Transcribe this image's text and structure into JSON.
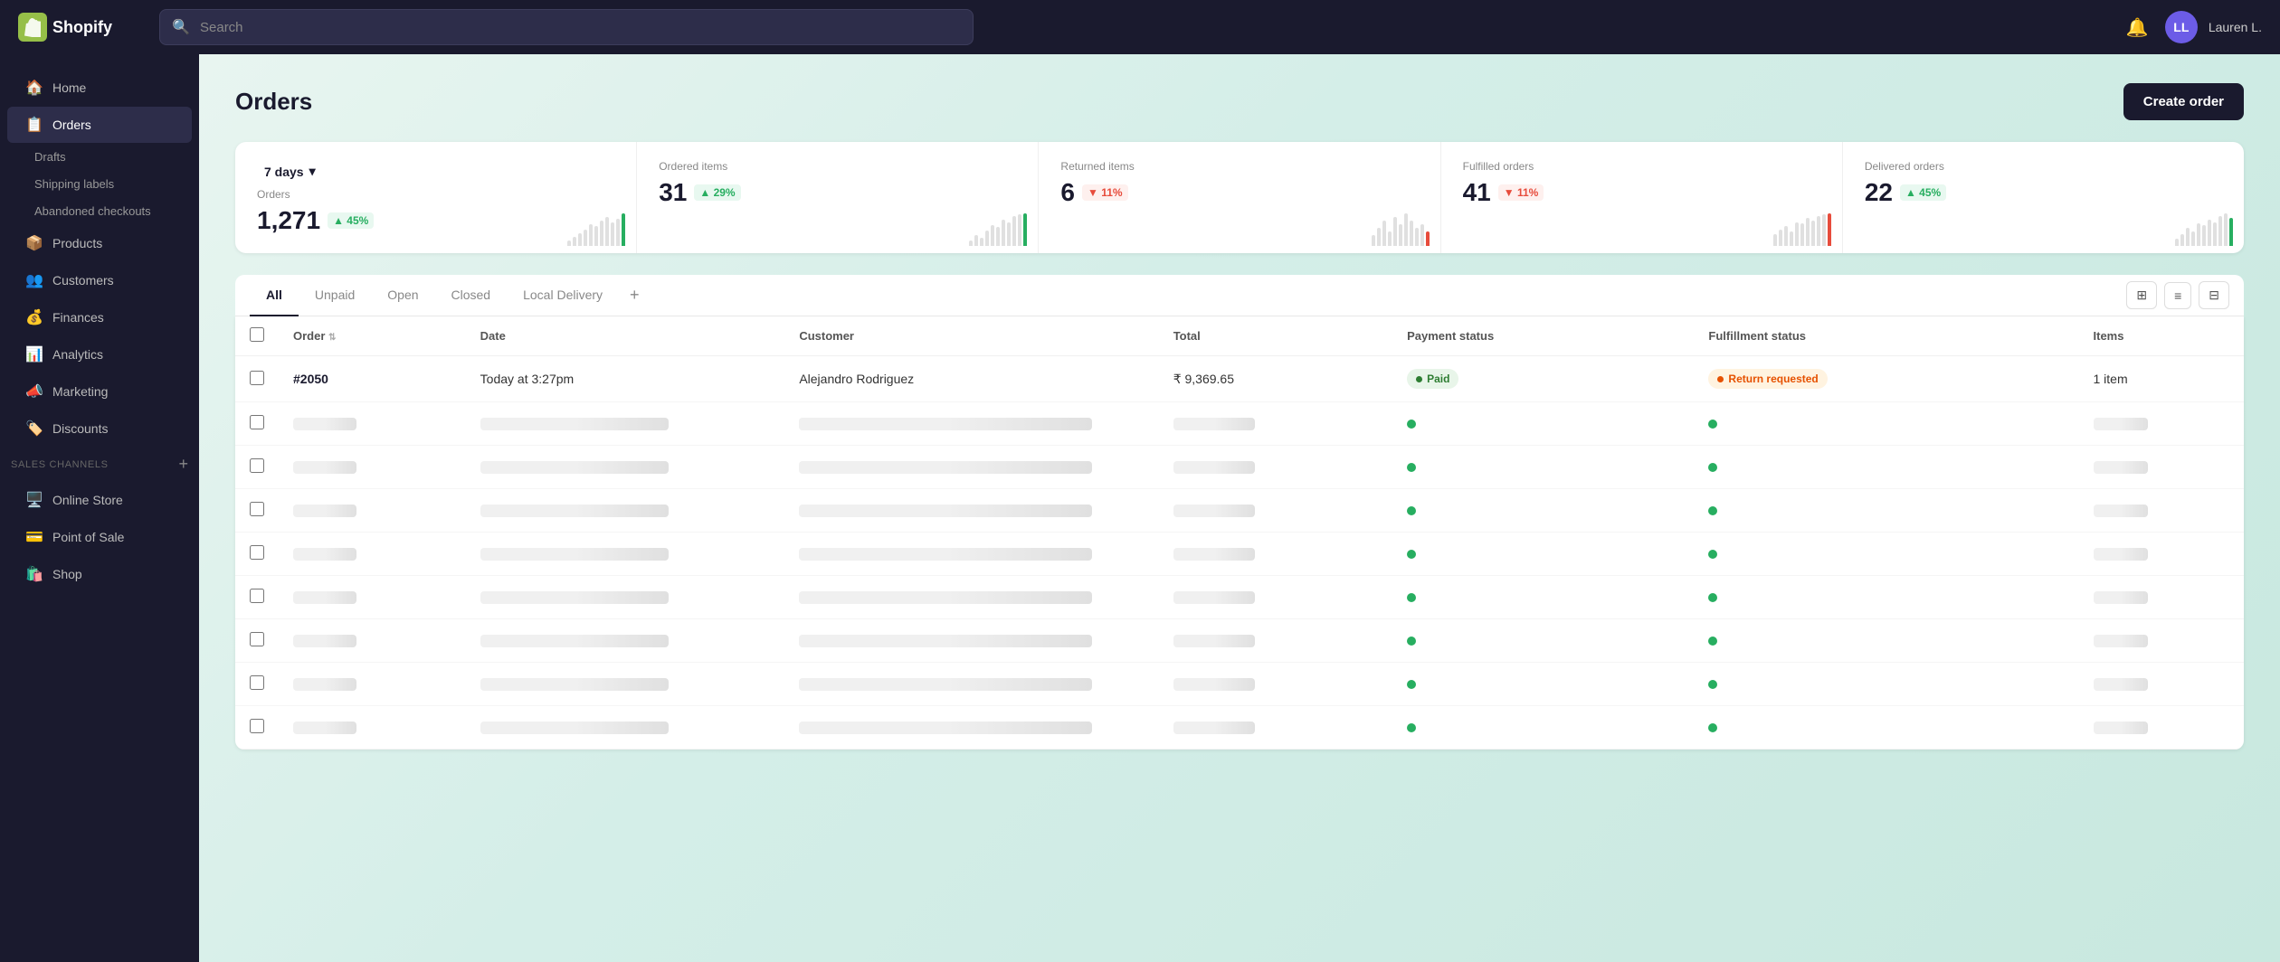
{
  "app": {
    "title": "Shopify",
    "logo_letter": "S"
  },
  "topnav": {
    "search_placeholder": "Search",
    "user_name": "Lauren L.",
    "user_initials": "LL"
  },
  "sidebar": {
    "main_items": [
      {
        "id": "home",
        "label": "Home",
        "icon": "🏠"
      },
      {
        "id": "orders",
        "label": "Orders",
        "icon": "📋",
        "active": true
      },
      {
        "id": "products",
        "label": "Products",
        "icon": "📦"
      },
      {
        "id": "customers",
        "label": "Customers",
        "icon": "👥"
      },
      {
        "id": "finances",
        "label": "Finances",
        "icon": "💰"
      },
      {
        "id": "analytics",
        "label": "Analytics",
        "icon": "📊"
      },
      {
        "id": "marketing",
        "label": "Marketing",
        "icon": "📣"
      },
      {
        "id": "discounts",
        "label": "Discounts",
        "icon": "🏷️"
      }
    ],
    "orders_sub": [
      {
        "id": "drafts",
        "label": "Drafts"
      },
      {
        "id": "shipping-labels",
        "label": "Shipping labels"
      },
      {
        "id": "abandoned-checkouts",
        "label": "Abandoned checkouts"
      }
    ],
    "sales_channels_label": "Sales channels",
    "sales_channels": [
      {
        "id": "online-store",
        "label": "Online Store",
        "icon": "🖥️"
      },
      {
        "id": "point-of-sale",
        "label": "Point of Sale",
        "icon": "💳"
      },
      {
        "id": "shop",
        "label": "Shop",
        "icon": "🛍️"
      }
    ]
  },
  "page": {
    "title": "Orders",
    "create_order_label": "Create order"
  },
  "stats": {
    "days_selector": "7 days",
    "cards": [
      {
        "id": "orders-count",
        "label": "Orders",
        "value": "1,271",
        "badge": "45%",
        "badge_type": "up",
        "bars": [
          8,
          12,
          18,
          22,
          30,
          28,
          35,
          40,
          32,
          38,
          45
        ]
      },
      {
        "id": "ordered-items",
        "label": "Ordered items",
        "value": "31",
        "badge": "29%",
        "badge_type": "up",
        "bars": [
          5,
          10,
          8,
          15,
          20,
          18,
          25,
          22,
          28,
          30,
          31
        ]
      },
      {
        "id": "returned-items",
        "label": "Returned items",
        "value": "6",
        "badge": "11%",
        "badge_type": "down",
        "bars": [
          3,
          5,
          7,
          4,
          8,
          6,
          9,
          7,
          5,
          6,
          4
        ]
      },
      {
        "id": "fulfilled-orders",
        "label": "Fulfilled orders",
        "value": "41",
        "badge": "11%",
        "badge_type": "down",
        "bars": [
          15,
          20,
          25,
          18,
          30,
          28,
          35,
          32,
          38,
          40,
          41
        ]
      },
      {
        "id": "delivered-orders",
        "label": "Delivered orders",
        "value": "22",
        "badge": "45%",
        "badge_type": "up",
        "bars": [
          5,
          8,
          12,
          10,
          15,
          14,
          18,
          16,
          20,
          22,
          19
        ]
      }
    ]
  },
  "tabs": {
    "items": [
      {
        "id": "all",
        "label": "All",
        "active": true
      },
      {
        "id": "unpaid",
        "label": "Unpaid"
      },
      {
        "id": "open",
        "label": "Open"
      },
      {
        "id": "closed",
        "label": "Closed"
      },
      {
        "id": "local-delivery",
        "label": "Local Delivery"
      }
    ],
    "add_tab_title": "Add tab"
  },
  "table": {
    "columns": [
      {
        "id": "order",
        "label": "Order",
        "sortable": true
      },
      {
        "id": "date",
        "label": "Date"
      },
      {
        "id": "customer",
        "label": "Customer"
      },
      {
        "id": "total",
        "label": "Total"
      },
      {
        "id": "payment-status",
        "label": "Payment status"
      },
      {
        "id": "fulfillment-status",
        "label": "Fulfillment status"
      },
      {
        "id": "items",
        "label": "Items"
      }
    ],
    "rows": [
      {
        "id": "2050",
        "order": "#2050",
        "date": "Today at 3:27pm",
        "customer": "Alejandro Rodriguez",
        "total": "₹ 9,369.65",
        "payment_status": "Paid",
        "payment_badge": "paid",
        "fulfillment_status": "Return requested",
        "fulfillment_badge": "return",
        "items": "1 item",
        "loading": false
      },
      {
        "id": "r2",
        "loading": true
      },
      {
        "id": "r3",
        "loading": true
      },
      {
        "id": "r4",
        "loading": true
      },
      {
        "id": "r5",
        "loading": true
      },
      {
        "id": "r6",
        "loading": true
      },
      {
        "id": "r7",
        "loading": true
      },
      {
        "id": "r8",
        "loading": true
      },
      {
        "id": "r9",
        "loading": true
      }
    ]
  }
}
